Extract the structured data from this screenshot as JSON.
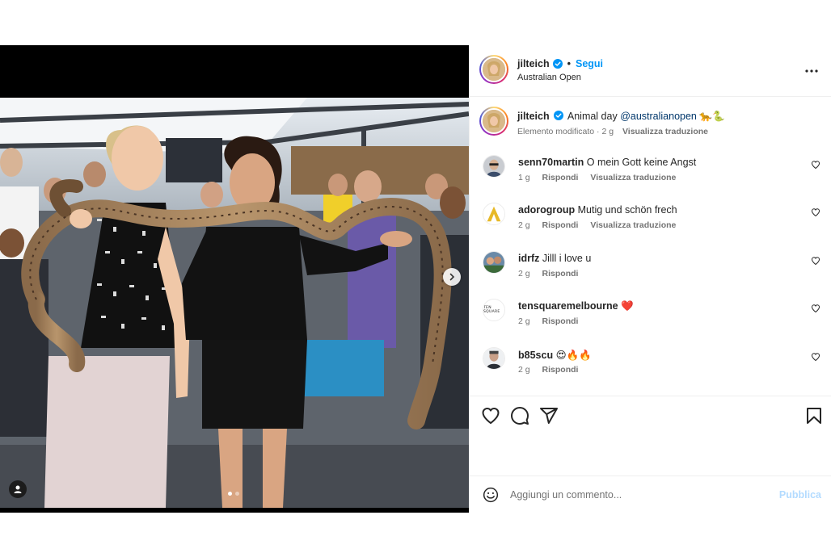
{
  "post": {
    "username": "jilteich",
    "follow_label": "Segui",
    "separator": "•",
    "location": "Australian Open",
    "more_icon": "more-horizontal-icon",
    "verified_icon": "verified-badge-icon"
  },
  "caption": {
    "username": "jilteich",
    "text_before": "Animal day ",
    "mention": "@australianopen",
    "emoji": "🐆🐍",
    "edited": "Elemento modificato · 2 g",
    "translate": "Visualizza traduzione"
  },
  "comments": [
    {
      "username": "senn70martin",
      "text": "O mein Gott keine Angst",
      "time": "1 g",
      "reply": "Rispondi",
      "translate": "Visualizza traduzione"
    },
    {
      "username": "adorogroup",
      "text": "Mutig und schön frech",
      "time": "2 g",
      "reply": "Rispondi",
      "translate": "Visualizza traduzione"
    },
    {
      "username": "idrfz",
      "text": "Jilll i love u",
      "time": "2 g",
      "reply": "Rispondi"
    },
    {
      "username": "tensquaremelbourne",
      "text": "❤️",
      "time": "2 g",
      "reply": "Rispondi",
      "avatar_text": "TEN SQUARE"
    },
    {
      "username": "b85scu",
      "text": "😍🔥🔥",
      "time": "2 g",
      "reply": "Rispondi"
    }
  ],
  "actions": {
    "like_icon": "heart-icon",
    "comment_icon": "comment-icon",
    "share_icon": "send-icon",
    "save_icon": "bookmark-icon"
  },
  "composer": {
    "placeholder": "Aggiungi un commento...",
    "publish_label": "Pubblica",
    "emoji_icon": "emoji-icon"
  },
  "carousel": {
    "current": 1,
    "total": 2
  },
  "colors": {
    "link": "#0095f6",
    "mention": "#00376b",
    "publish_disabled": "#b3dbff",
    "muted": "#737373"
  }
}
